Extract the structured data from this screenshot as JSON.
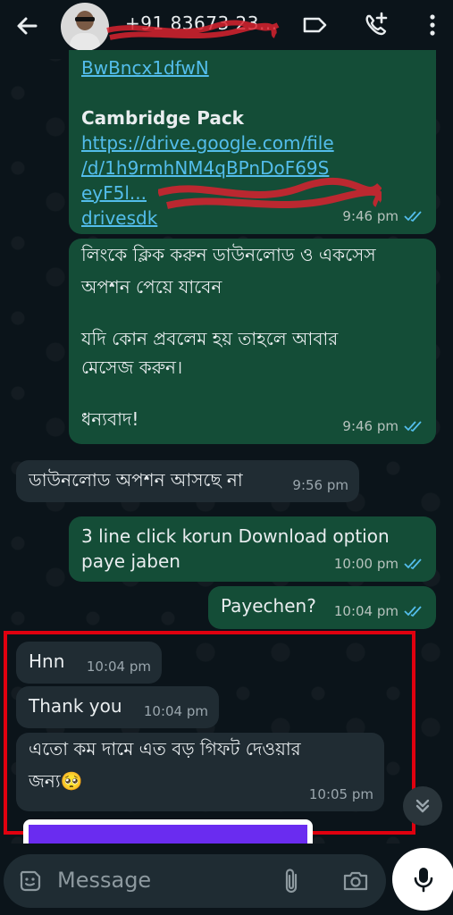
{
  "header": {
    "contact_name": "+91 83673 23..."
  },
  "messages": [
    {
      "id": "m1",
      "direction": "outgoing",
      "link_top": "BwBncx1dfwN",
      "title": "Cambridge Pack",
      "link_lines": [
        "https://drive.google.com/file",
        "/d/1h9rmhNM4qBPnDoF69S",
        "eyF5l...",
        "drivesdk"
      ],
      "time": "9:46 pm"
    },
    {
      "id": "m2",
      "direction": "outgoing",
      "lines": [
        "লিংকে ক্লিক করুন ডাউনলোড ও একসেস",
        "অপশন পেয়ে যাবেন",
        "",
        "যদি কোন প্রবলেম হয় তাহলে আবার",
        "মেসেজ করুন।",
        "",
        "ধন্যবাদ!"
      ],
      "time": "9:46 pm"
    },
    {
      "id": "m3",
      "direction": "incoming",
      "text": "ডাউনলোড অপশন আসছে না",
      "time": "9:56 pm"
    },
    {
      "id": "m4",
      "direction": "outgoing",
      "lines": [
        "3 line click korun Download option",
        "paye jaben"
      ],
      "time": "10:00 pm"
    },
    {
      "id": "m5",
      "direction": "outgoing",
      "text": "Payechen?",
      "time": "10:04 pm"
    },
    {
      "id": "m6",
      "direction": "incoming",
      "text": "Hnn",
      "time": "10:04 pm"
    },
    {
      "id": "m7",
      "direction": "incoming",
      "text": "Thank you",
      "time": "10:04 pm"
    },
    {
      "id": "m8",
      "direction": "incoming",
      "lines": [
        "এতো কম দামে এত বড় গিফট দেওয়ার",
        "জন্য🥺"
      ],
      "time": "10:05 pm"
    }
  ],
  "composer": {
    "placeholder": "Message"
  },
  "colors": {
    "background": "#0b141a",
    "outgoing_bubble": "#144d37",
    "incoming_bubble": "#202c33",
    "link": "#53bdeb",
    "read_ticks": "#53bdeb",
    "highlight_box": "#e0000f"
  }
}
